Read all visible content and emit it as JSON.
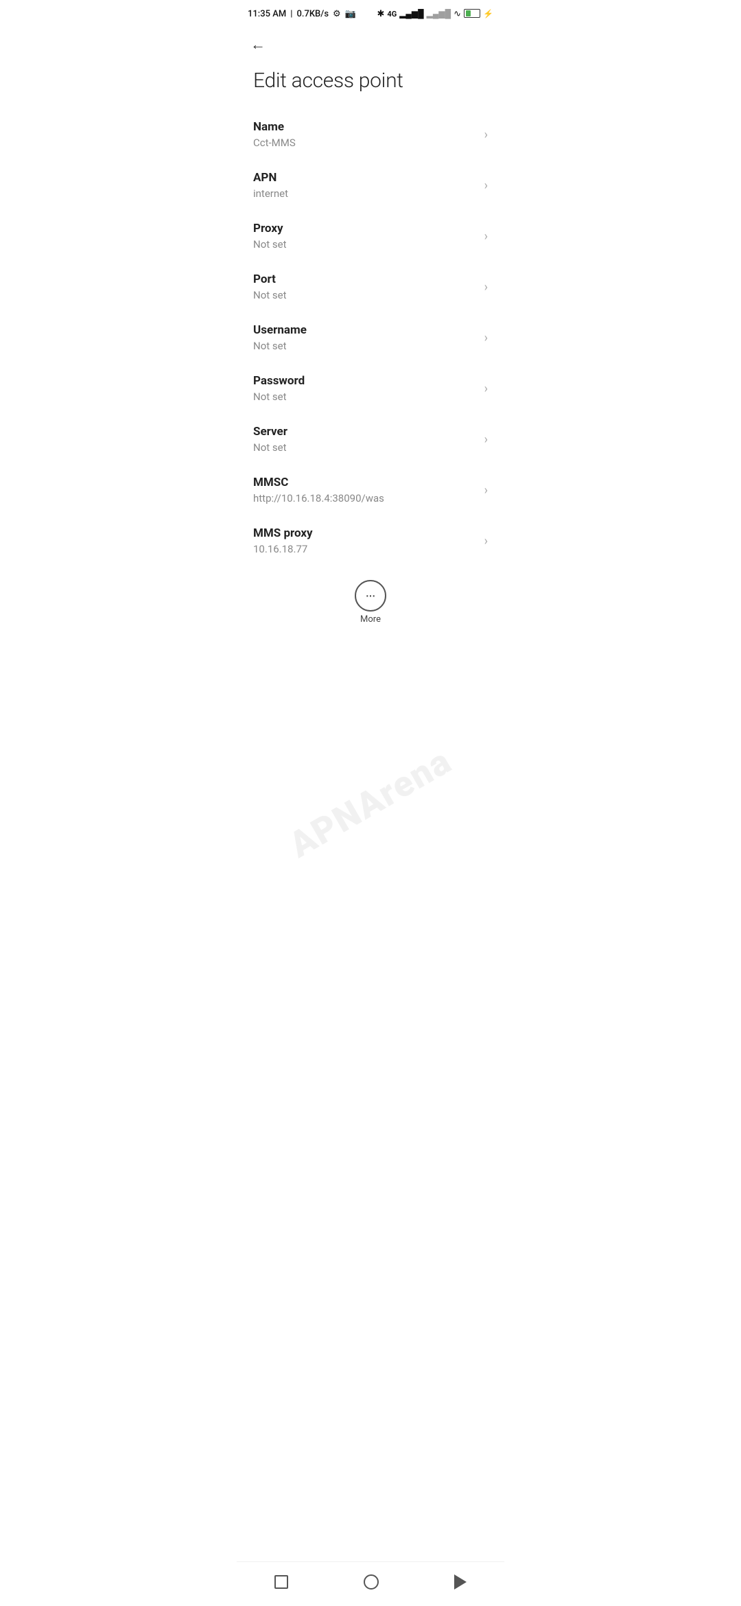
{
  "statusBar": {
    "time": "11:35 AM",
    "speed": "0.7KB/s"
  },
  "header": {
    "backLabel": "←",
    "title": "Edit access point"
  },
  "items": [
    {
      "label": "Name",
      "value": "Cct-MMS"
    },
    {
      "label": "APN",
      "value": "internet"
    },
    {
      "label": "Proxy",
      "value": "Not set"
    },
    {
      "label": "Port",
      "value": "Not set"
    },
    {
      "label": "Username",
      "value": "Not set"
    },
    {
      "label": "Password",
      "value": "Not set"
    },
    {
      "label": "Server",
      "value": "Not set"
    },
    {
      "label": "MMSC",
      "value": "http://10.16.18.4:38090/was"
    },
    {
      "label": "MMS proxy",
      "value": "10.16.18.77"
    }
  ],
  "more": {
    "label": "More",
    "icon": "···"
  },
  "watermark": "APNArena"
}
